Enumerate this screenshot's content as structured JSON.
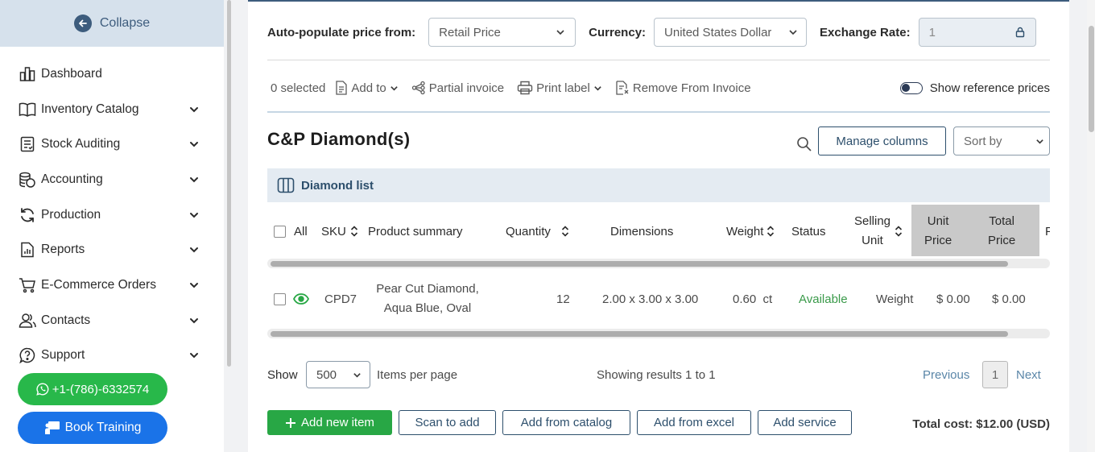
{
  "sidebar": {
    "collapse_label": "Collapse",
    "items": [
      {
        "label": "Dashboard",
        "has_chevron": false
      },
      {
        "label": "Inventory Catalog",
        "has_chevron": true
      },
      {
        "label": "Stock Auditing",
        "has_chevron": true
      },
      {
        "label": "Accounting",
        "has_chevron": true
      },
      {
        "label": "Production",
        "has_chevron": true
      },
      {
        "label": "Reports",
        "has_chevron": true
      },
      {
        "label": "E-Commerce Orders",
        "has_chevron": true
      },
      {
        "label": "Contacts",
        "has_chevron": true
      },
      {
        "label": "Support",
        "has_chevron": true
      }
    ],
    "phone_label": "+1-(786)-6332574",
    "training_label": "Book Training"
  },
  "settings": {
    "autopopulate_label": "Auto-populate price from:",
    "autopopulate_value": "Retail Price",
    "currency_label": "Currency:",
    "currency_value": "United States Dollar",
    "exchange_label": "Exchange Rate:",
    "exchange_value": "1"
  },
  "actions": {
    "selected": "0 selected",
    "add_to": "Add to",
    "partial_invoice": "Partial invoice",
    "print_label": "Print label",
    "remove_from_invoice": "Remove From Invoice",
    "show_reference_prices": "Show reference prices"
  },
  "section": {
    "title": "C&P Diamond(s)",
    "manage_columns": "Manage columns",
    "sort_by": "Sort by",
    "list_title": "Diamond list"
  },
  "table": {
    "headers": {
      "all": "All",
      "sku": "SKU",
      "summary": "Product summary",
      "quantity": "Quantity",
      "dimensions": "Dimensions",
      "weight": "Weight",
      "status": "Status",
      "selling_1": "Selling",
      "selling_2": "Unit",
      "unit_price_1": "Unit",
      "unit_price_2": "Price",
      "total_price_1": "Total",
      "total_price_2": "Price",
      "next_col": "F"
    },
    "rows": [
      {
        "sku": "CPD7",
        "summary_1": "Pear Cut Diamond,",
        "summary_2": "Aqua Blue, Oval",
        "quantity": "12",
        "dimensions": "2.00 x 3.00 x 3.00",
        "weight": "0.60  ct",
        "status": "Available",
        "selling_unit": "Weight",
        "unit_price": "$ 0.00",
        "total_price": "$ 0.00"
      }
    ],
    "status_color": "#3a9a4a"
  },
  "pagination": {
    "show_label": "Show",
    "per_page": "500",
    "items_per_page": "Items per page",
    "showing": "Showing results 1 to 1",
    "previous": "Previous",
    "page": "1",
    "next": "Next"
  },
  "footer": {
    "add_new_item": "Add new item",
    "scan_to_add": "Scan to add",
    "add_from_catalog": "Add from catalog",
    "add_from_excel": "Add from excel",
    "add_service": "Add service",
    "total_cost": "Total cost: $12.00 (USD)"
  },
  "colors": {
    "accent": "#2d4f6c",
    "green": "#28a745",
    "blue": "#1a73e8"
  }
}
